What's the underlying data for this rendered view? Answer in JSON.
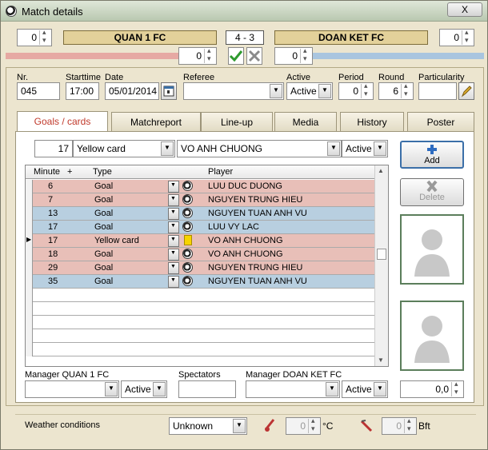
{
  "window": {
    "title": "Match details",
    "close_label": "X"
  },
  "match": {
    "home_team": "QUAN 1 FC",
    "away_team": "DOAN KET FC",
    "score": "4 - 3",
    "home_value": "0",
    "away_value": "0",
    "home_sub_value": "0",
    "away_sub_value": "0"
  },
  "details": {
    "nr_label": "Nr.",
    "nr": "045",
    "starttime_label": "Starttime",
    "starttime": "17:00",
    "date_label": "Date",
    "date": "05/01/2014",
    "referee_label": "Referee",
    "referee": "",
    "active_label": "Active",
    "active": "Active",
    "period_label": "Period",
    "period": "0",
    "round_label": "Round",
    "round": "6",
    "particularity_label": "Particularity",
    "particularity": ""
  },
  "tabs": [
    "Goals / cards",
    "Matchreport",
    "Line-up",
    "Media",
    "History",
    "Poster"
  ],
  "entry": {
    "minute": "17",
    "type": "Yellow card",
    "player": "VO ANH CHUONG",
    "status": "Active"
  },
  "buttons": {
    "add": "Add",
    "delete": "Delete"
  },
  "table": {
    "columns": [
      "Minute",
      "+",
      "Type",
      "Player"
    ],
    "rows": [
      {
        "minute": "6",
        "type": "Goal",
        "player": "LUU DUC DUONG",
        "team": "a",
        "icon": "ball-icon"
      },
      {
        "minute": "7",
        "type": "Goal",
        "player": "NGUYEN TRUNG HIEU",
        "team": "a",
        "icon": "ball-icon"
      },
      {
        "minute": "13",
        "type": "Goal",
        "player": "NGUYEN TUAN ANH VU",
        "team": "b",
        "icon": "ball-icon"
      },
      {
        "minute": "17",
        "type": "Goal",
        "player": "LUU VY LAC",
        "team": "b",
        "icon": "ball-icon"
      },
      {
        "minute": "17",
        "type": "Yellow card",
        "player": "VO ANH CHUONG",
        "team": "a",
        "icon": "yellow-card-icon"
      },
      {
        "minute": "18",
        "type": "Goal",
        "player": "VO ANH CHUONG",
        "team": "a",
        "icon": "ball-icon"
      },
      {
        "minute": "29",
        "type": "Goal",
        "player": "NGUYEN TRUNG HIEU",
        "team": "a",
        "icon": "ball-icon"
      },
      {
        "minute": "35",
        "type": "Goal",
        "player": "NGUYEN TUAN ANH VU",
        "team": "b",
        "icon": "ball-icon"
      }
    ]
  },
  "managers": {
    "home_label": "Manager QUAN 1 FC",
    "home_value": "",
    "home_status": "Active",
    "spectators_label": "Spectators",
    "spectators": "",
    "away_label": "Manager DOAN KET FC",
    "away_value": "",
    "away_status": "Active",
    "rating": "0,0"
  },
  "weather": {
    "label": "Weather conditions",
    "value": "Unknown",
    "temperature": "0",
    "temperature_unit": "°C",
    "wind": "0",
    "wind_unit": "Bft"
  },
  "colors": {
    "team_a_row": "#e8bfb8",
    "team_b_row": "#b8cfe0",
    "gold": "#e3d19a",
    "active_tab_text": "#c0392b"
  }
}
